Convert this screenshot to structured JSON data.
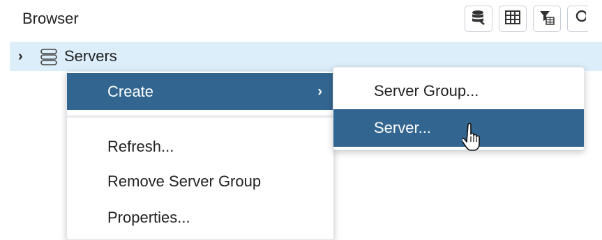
{
  "header": {
    "title": "Browser",
    "toolbar": [
      {
        "icon": "database-query-icon"
      },
      {
        "icon": "table-grid-icon"
      },
      {
        "icon": "filter-table-icon"
      },
      {
        "icon": "search-icon"
      }
    ]
  },
  "tree": {
    "node_label": "Servers",
    "node_icon": "server-stack-icon",
    "expander_icon": "chevron-right-icon"
  },
  "context_menu": {
    "items": [
      {
        "label": "Create",
        "has_submenu": true
      },
      {
        "label": "Refresh..."
      },
      {
        "label": "Remove Server Group"
      },
      {
        "label": "Properties..."
      }
    ]
  },
  "submenu": {
    "items": [
      {
        "label": "Server Group..."
      },
      {
        "label": "Server..."
      }
    ]
  },
  "colors": {
    "active_menu_bg": "#326690",
    "selected_row_bg": "#dbeefa"
  }
}
